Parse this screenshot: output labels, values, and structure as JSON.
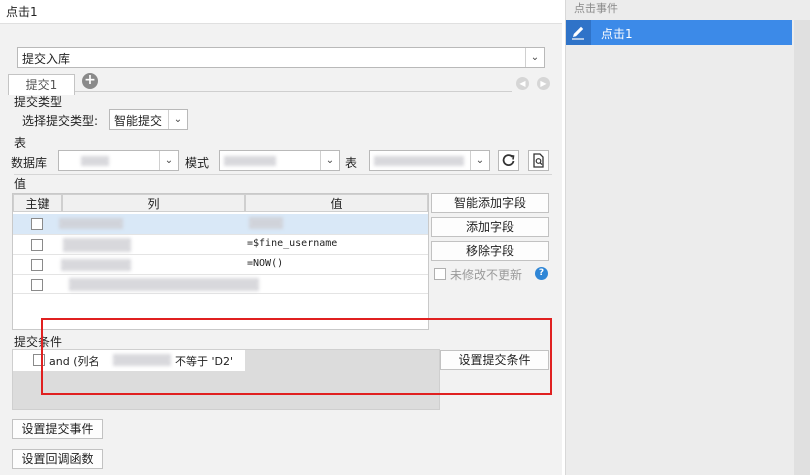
{
  "dialog": {
    "title": "点击1"
  },
  "action_select": {
    "value": "提交入库"
  },
  "tabs": [
    {
      "label": "提交1"
    }
  ],
  "submit_type": {
    "section_label": "提交类型",
    "field_label": "选择提交类型:",
    "value": "智能提交"
  },
  "table_section": {
    "section_label": "表",
    "db_label": "数据库",
    "schema_label": "模式",
    "table_label": "表"
  },
  "values_section": {
    "section_label": "值",
    "headers": {
      "key": "主键",
      "column": "列",
      "value": "值"
    },
    "rows": [
      {
        "value": ""
      },
      {
        "value": "=$fine_username"
      },
      {
        "value": "=NOW()"
      },
      {
        "value": ""
      }
    ],
    "buttons": {
      "smart_add": "智能添加字段",
      "add": "添加字段",
      "remove": "移除字段"
    },
    "no_update_label": "未修改不更新",
    "help_icon": "?"
  },
  "condition_section": {
    "section_label": "提交条件",
    "condition_prefix": "and (列名",
    "condition_suffix": "不等于 'D2'",
    "set_button": "设置提交条件"
  },
  "bottom_buttons": {
    "submit_event": "设置提交事件",
    "callback": "设置回调函数"
  },
  "event_panel": {
    "header": "点击事件",
    "items": [
      {
        "label": "点击1",
        "selected": true
      }
    ]
  },
  "colors": {
    "selected": "#3c8ae8",
    "highlight_box": "#e02020",
    "selected_row": "#d9e8f7"
  }
}
